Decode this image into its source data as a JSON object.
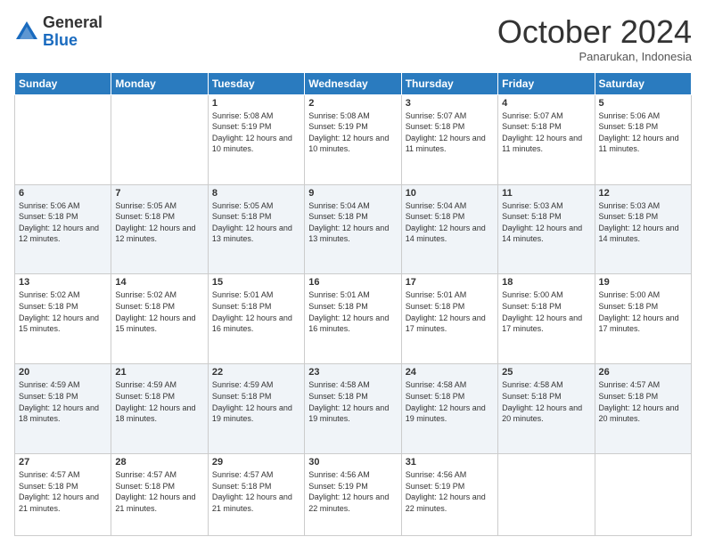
{
  "header": {
    "logo_general": "General",
    "logo_blue": "Blue",
    "month_title": "October 2024",
    "location": "Panarukan, Indonesia"
  },
  "days_of_week": [
    "Sunday",
    "Monday",
    "Tuesday",
    "Wednesday",
    "Thursday",
    "Friday",
    "Saturday"
  ],
  "weeks": [
    [
      {
        "day": "",
        "info": ""
      },
      {
        "day": "",
        "info": ""
      },
      {
        "day": "1",
        "info": "Sunrise: 5:08 AM\nSunset: 5:19 PM\nDaylight: 12 hours and 10 minutes."
      },
      {
        "day": "2",
        "info": "Sunrise: 5:08 AM\nSunset: 5:19 PM\nDaylight: 12 hours and 10 minutes."
      },
      {
        "day": "3",
        "info": "Sunrise: 5:07 AM\nSunset: 5:18 PM\nDaylight: 12 hours and 11 minutes."
      },
      {
        "day": "4",
        "info": "Sunrise: 5:07 AM\nSunset: 5:18 PM\nDaylight: 12 hours and 11 minutes."
      },
      {
        "day": "5",
        "info": "Sunrise: 5:06 AM\nSunset: 5:18 PM\nDaylight: 12 hours and 11 minutes."
      }
    ],
    [
      {
        "day": "6",
        "info": "Sunrise: 5:06 AM\nSunset: 5:18 PM\nDaylight: 12 hours and 12 minutes."
      },
      {
        "day": "7",
        "info": "Sunrise: 5:05 AM\nSunset: 5:18 PM\nDaylight: 12 hours and 12 minutes."
      },
      {
        "day": "8",
        "info": "Sunrise: 5:05 AM\nSunset: 5:18 PM\nDaylight: 12 hours and 13 minutes."
      },
      {
        "day": "9",
        "info": "Sunrise: 5:04 AM\nSunset: 5:18 PM\nDaylight: 12 hours and 13 minutes."
      },
      {
        "day": "10",
        "info": "Sunrise: 5:04 AM\nSunset: 5:18 PM\nDaylight: 12 hours and 14 minutes."
      },
      {
        "day": "11",
        "info": "Sunrise: 5:03 AM\nSunset: 5:18 PM\nDaylight: 12 hours and 14 minutes."
      },
      {
        "day": "12",
        "info": "Sunrise: 5:03 AM\nSunset: 5:18 PM\nDaylight: 12 hours and 14 minutes."
      }
    ],
    [
      {
        "day": "13",
        "info": "Sunrise: 5:02 AM\nSunset: 5:18 PM\nDaylight: 12 hours and 15 minutes."
      },
      {
        "day": "14",
        "info": "Sunrise: 5:02 AM\nSunset: 5:18 PM\nDaylight: 12 hours and 15 minutes."
      },
      {
        "day": "15",
        "info": "Sunrise: 5:01 AM\nSunset: 5:18 PM\nDaylight: 12 hours and 16 minutes."
      },
      {
        "day": "16",
        "info": "Sunrise: 5:01 AM\nSunset: 5:18 PM\nDaylight: 12 hours and 16 minutes."
      },
      {
        "day": "17",
        "info": "Sunrise: 5:01 AM\nSunset: 5:18 PM\nDaylight: 12 hours and 17 minutes."
      },
      {
        "day": "18",
        "info": "Sunrise: 5:00 AM\nSunset: 5:18 PM\nDaylight: 12 hours and 17 minutes."
      },
      {
        "day": "19",
        "info": "Sunrise: 5:00 AM\nSunset: 5:18 PM\nDaylight: 12 hours and 17 minutes."
      }
    ],
    [
      {
        "day": "20",
        "info": "Sunrise: 4:59 AM\nSunset: 5:18 PM\nDaylight: 12 hours and 18 minutes."
      },
      {
        "day": "21",
        "info": "Sunrise: 4:59 AM\nSunset: 5:18 PM\nDaylight: 12 hours and 18 minutes."
      },
      {
        "day": "22",
        "info": "Sunrise: 4:59 AM\nSunset: 5:18 PM\nDaylight: 12 hours and 19 minutes."
      },
      {
        "day": "23",
        "info": "Sunrise: 4:58 AM\nSunset: 5:18 PM\nDaylight: 12 hours and 19 minutes."
      },
      {
        "day": "24",
        "info": "Sunrise: 4:58 AM\nSunset: 5:18 PM\nDaylight: 12 hours and 19 minutes."
      },
      {
        "day": "25",
        "info": "Sunrise: 4:58 AM\nSunset: 5:18 PM\nDaylight: 12 hours and 20 minutes."
      },
      {
        "day": "26",
        "info": "Sunrise: 4:57 AM\nSunset: 5:18 PM\nDaylight: 12 hours and 20 minutes."
      }
    ],
    [
      {
        "day": "27",
        "info": "Sunrise: 4:57 AM\nSunset: 5:18 PM\nDaylight: 12 hours and 21 minutes."
      },
      {
        "day": "28",
        "info": "Sunrise: 4:57 AM\nSunset: 5:18 PM\nDaylight: 12 hours and 21 minutes."
      },
      {
        "day": "29",
        "info": "Sunrise: 4:57 AM\nSunset: 5:18 PM\nDaylight: 12 hours and 21 minutes."
      },
      {
        "day": "30",
        "info": "Sunrise: 4:56 AM\nSunset: 5:19 PM\nDaylight: 12 hours and 22 minutes."
      },
      {
        "day": "31",
        "info": "Sunrise: 4:56 AM\nSunset: 5:19 PM\nDaylight: 12 hours and 22 minutes."
      },
      {
        "day": "",
        "info": ""
      },
      {
        "day": "",
        "info": ""
      }
    ]
  ]
}
